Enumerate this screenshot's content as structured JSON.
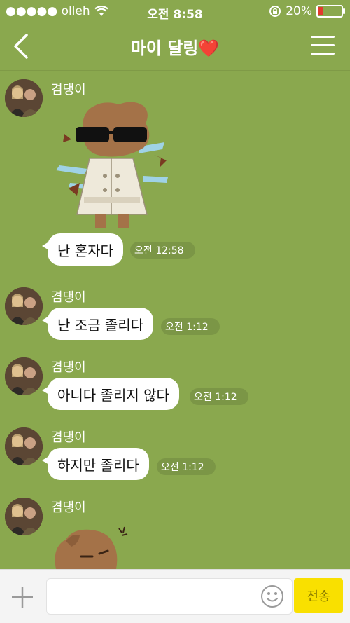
{
  "status_bar": {
    "carrier": "●●●●● olleh",
    "time": "오전 8:58",
    "battery_percent": "20%",
    "battery_level": 0.2
  },
  "nav": {
    "title": "마이 달링",
    "title_emoji": "❤️",
    "back_icon": "chevron-left-icon",
    "menu_icon": "hamburger-menu-icon"
  },
  "messages": [
    {
      "sender": "겸댕이",
      "type": "sticker",
      "sticker": "ryan-trench-coat-sunglasses"
    },
    {
      "type": "text",
      "text": "난 혼자다",
      "time": "오전 12:58"
    },
    {
      "sender": "겸댕이",
      "type": "text",
      "text": "난 조금 졸리다",
      "time": "오전 1:12"
    },
    {
      "sender": "겸댕이",
      "type": "text",
      "text": "아니다 졸리지 않다",
      "time": "오전 1:12"
    },
    {
      "sender": "겸댕이",
      "type": "text",
      "text": "하지만 졸리다",
      "time": "오전 1:12"
    },
    {
      "sender": "겸댕이",
      "type": "sticker",
      "sticker": "ryan-sleepy"
    }
  ],
  "input_bar": {
    "placeholder": "",
    "send_label": "전송",
    "plus_icon": "plus-icon",
    "emoji_icon": "smiley-icon"
  },
  "colors": {
    "background": "#8aa84e",
    "send_button": "#f9e000",
    "bubble": "#ffffff"
  }
}
